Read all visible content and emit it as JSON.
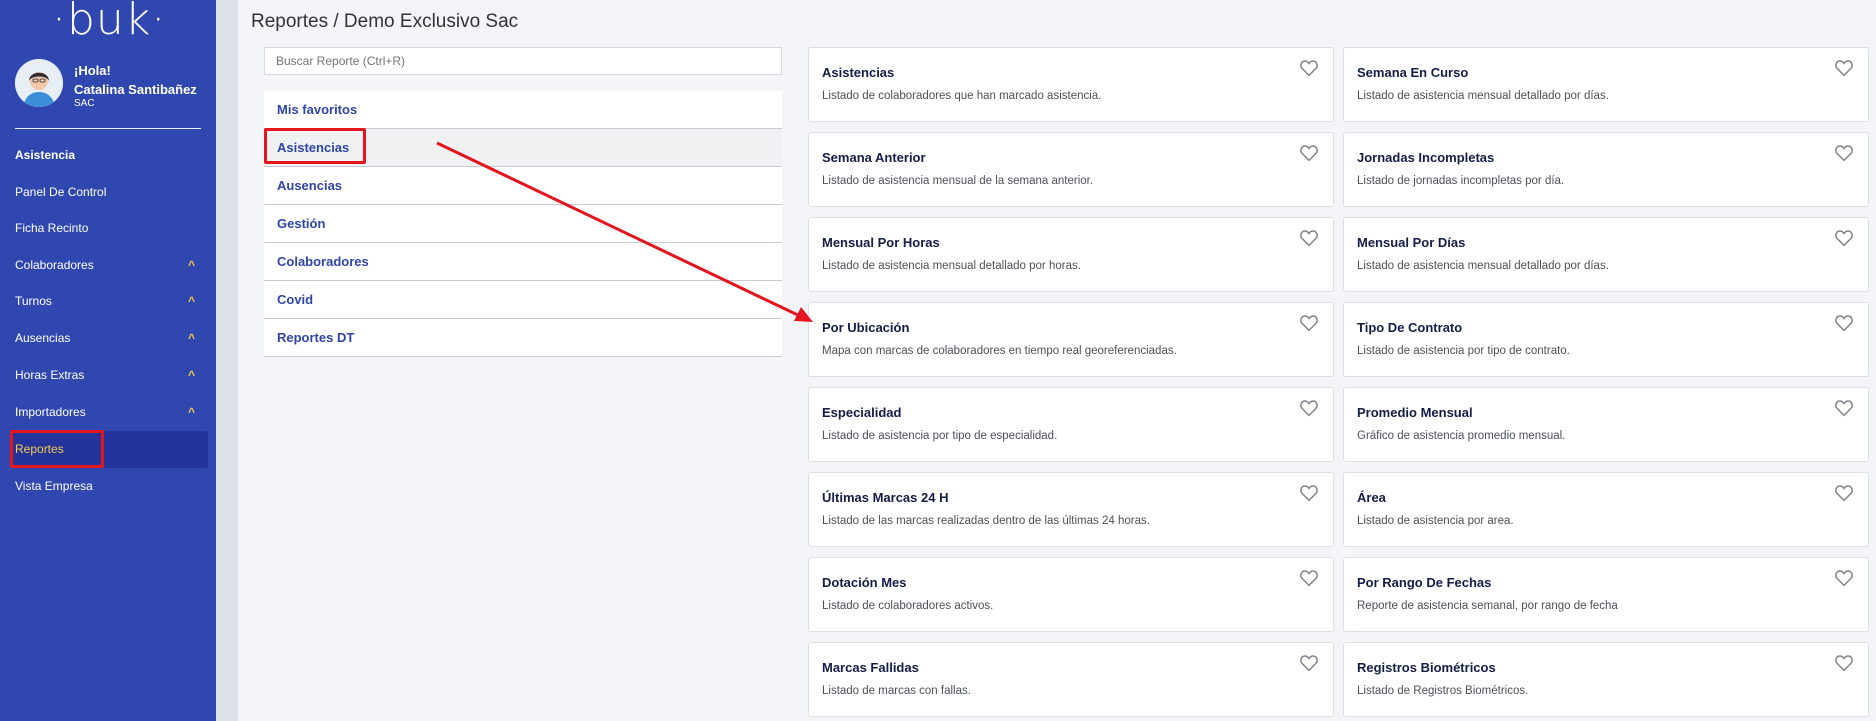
{
  "brand": {
    "logo": "·buk·"
  },
  "user": {
    "greeting": "¡Hola!",
    "name": "Catalina Santibañez",
    "role": "SAC"
  },
  "sidebar": {
    "items": [
      {
        "label": "Asistencia",
        "chevron": ""
      },
      {
        "label": "Panel De Control",
        "chevron": ""
      },
      {
        "label": "Ficha Recinto",
        "chevron": ""
      },
      {
        "label": "Colaboradores",
        "chevron": "^"
      },
      {
        "label": "Turnos",
        "chevron": "^"
      },
      {
        "label": "Ausencias",
        "chevron": "^"
      },
      {
        "label": "Horas Extras",
        "chevron": "^"
      },
      {
        "label": "Importadores",
        "chevron": "^"
      },
      {
        "label": "Reportes",
        "chevron": ""
      },
      {
        "label": "Vista Empresa",
        "chevron": ""
      }
    ]
  },
  "page": {
    "title": "Reportes / Demo Exclusivo Sac"
  },
  "search": {
    "placeholder": "Buscar Reporte (Ctrl+R)"
  },
  "categories": [
    "Mis favoritos",
    "Asistencias",
    "Ausencias",
    "Gestión",
    "Colaboradores",
    "Covid",
    "Reportes DT"
  ],
  "selected_category": "Asistencias",
  "reports": [
    {
      "title": "Asistencias",
      "desc": "Listado de colaboradores que han marcado asistencia."
    },
    {
      "title": "Semana En Curso",
      "desc": "Listado de asistencia mensual detallado por días."
    },
    {
      "title": "Semana Anterior",
      "desc": "Listado de asistencia mensual de la semana anterior."
    },
    {
      "title": "Jornadas Incompletas",
      "desc": "Listado de jornadas incompletas por día."
    },
    {
      "title": "Mensual Por Horas",
      "desc": "Listado de asistencia mensual detallado por horas."
    },
    {
      "title": "Mensual Por Días",
      "desc": "Listado de asistencia mensual detallado por días."
    },
    {
      "title": "Por Ubicación",
      "desc": "Mapa con marcas de colaboradores en tiempo real georeferenciadas."
    },
    {
      "title": "Tipo De Contrato",
      "desc": "Listado de asistencia por tipo de contrato."
    },
    {
      "title": "Especialidad",
      "desc": "Listado de asistencia por tipo de especialidad."
    },
    {
      "title": "Promedio Mensual",
      "desc": "Gráfico de asistencia promedio mensual."
    },
    {
      "title": "Últimas Marcas 24 H",
      "desc": "Listado de las marcas realizadas dentro de las últimas 24 horas."
    },
    {
      "title": "Área",
      "desc": "Listado de asistencia por area."
    },
    {
      "title": "Dotación Mes",
      "desc": "Listado de colaboradores activos."
    },
    {
      "title": "Por Rango De Fechas",
      "desc": "Reporte de asistencia semanal, por rango de fecha"
    },
    {
      "title": "Marcas Fallidas",
      "desc": "Listado de marcas con fallas."
    },
    {
      "title": "Registros Biométricos",
      "desc": "Listado de Registros Biométricos."
    }
  ],
  "colors": {
    "sidebar": "#3147b0",
    "accent": "#f3c94b",
    "highlight": "#e3161d",
    "link": "#2f45a7"
  }
}
